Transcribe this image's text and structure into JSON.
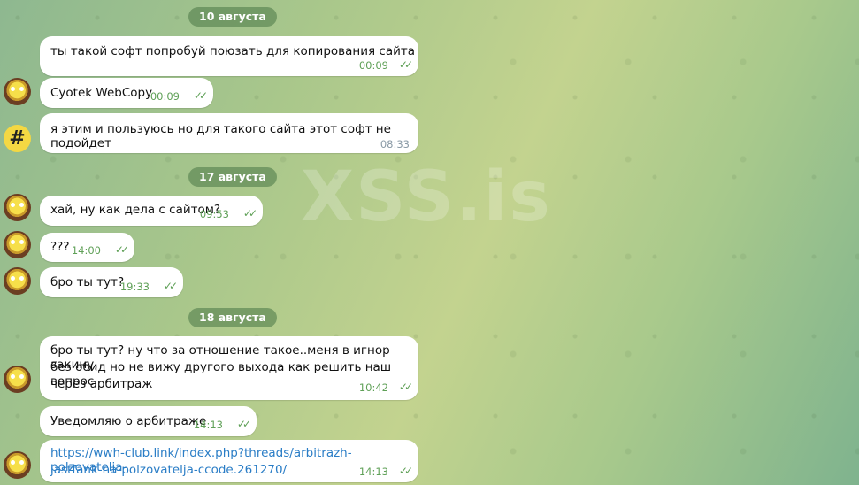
{
  "watermark": "XSS.is",
  "dates": [
    "10 августа",
    "17 августа",
    "18 августа"
  ],
  "messages": [
    {
      "text": "ты такой софт попробуй поюзать для копирования сайта",
      "time": "00:09"
    },
    {
      "text": "Cyotek WebCopy",
      "time": "00:09"
    },
    {
      "text": "я этим и пользуюсь но для такого сайта этот софт не подойдет",
      "time": "08:33"
    },
    {
      "text": "хай, ну как дела с сайтом?",
      "time": "09:53"
    },
    {
      "text": "???",
      "time": "14:00"
    },
    {
      "text": "бро ты тут?",
      "time": "19:33"
    },
    {
      "line1": "бро ты тут? ну что за отношение такое..меня в игнор закину,",
      "line2": "без обид но не вижу другого выхода как решить наш вопрос",
      "line3": "через арбитраж",
      "time": "10:42"
    },
    {
      "text": "Уведомляю о арбитраже",
      "time": "14:13"
    },
    {
      "line1": "https://wwh-club.link/index.php?threads/arbitrazh-polzovatelja-",
      "line2": "jastfank-na-polzovatelja-ccode.261270/",
      "time": "14:13"
    }
  ],
  "avatars": {
    "sponge": "spongebob-avatar",
    "hash": "#"
  },
  "colors": {
    "tick": "#5fa057",
    "link": "#2a7dc6"
  }
}
